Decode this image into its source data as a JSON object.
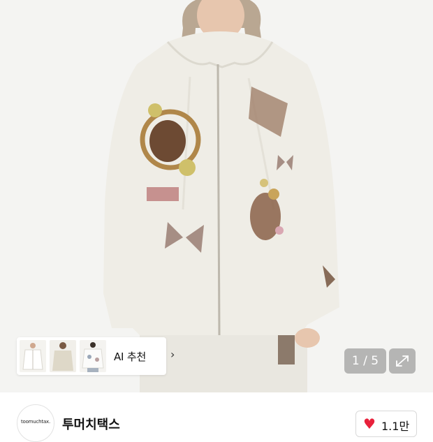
{
  "ai_recommend": {
    "label": "AI 추천",
    "chevron": "›",
    "thumbnails": [
      "thumb-white-zip-hoodie",
      "thumb-ivory-hoodie-model",
      "thumb-printed-hoodie"
    ]
  },
  "gallery": {
    "counter": "1 / 5",
    "expand_icon": "expand-arrows-icon"
  },
  "store": {
    "logo_text": "toomuchtax.",
    "name": "투머치택스"
  },
  "like": {
    "icon": "heart-icon",
    "count": "1.1만",
    "color": "#e8213b"
  },
  "colors": {
    "hero_background": "#f4f4f2",
    "hoodie": "#efede6"
  }
}
